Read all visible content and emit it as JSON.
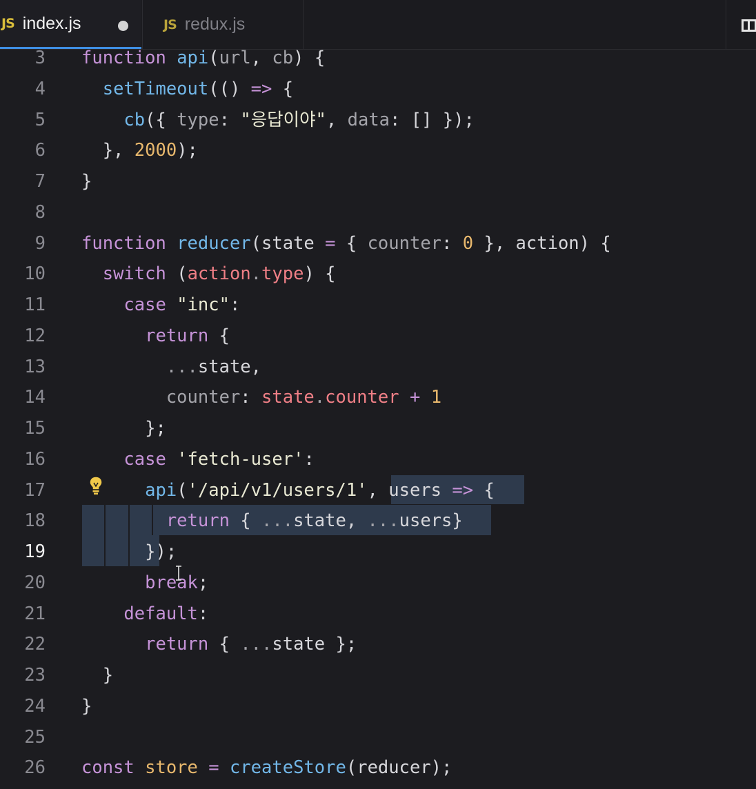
{
  "tabs": [
    {
      "icon": "JS",
      "name": "index.js",
      "dirty": true,
      "active": true
    },
    {
      "icon": "JS",
      "name": "redux.js",
      "dirty": false,
      "active": false
    }
  ],
  "editor": {
    "active_line": 19,
    "lines": [
      {
        "n": "3",
        "tokens": [
          [
            "kw",
            "function"
          ],
          [
            "pun",
            " "
          ],
          [
            "fn",
            "api"
          ],
          [
            "pun",
            "("
          ],
          [
            "dim",
            "url"
          ],
          [
            "pun",
            ", "
          ],
          [
            "dim",
            "cb"
          ],
          [
            "pun",
            ") {"
          ]
        ]
      },
      {
        "n": "4",
        "tokens": [
          [
            "pun",
            "  "
          ],
          [
            "fn",
            "setTimeout"
          ],
          [
            "pun",
            "(() "
          ],
          [
            "op",
            "=>"
          ],
          [
            "pun",
            " {"
          ]
        ]
      },
      {
        "n": "5",
        "tokens": [
          [
            "pun",
            "    "
          ],
          [
            "fn",
            "cb"
          ],
          [
            "pun",
            "({ "
          ],
          [
            "dim",
            "type"
          ],
          [
            "pun",
            ": "
          ],
          [
            "str",
            "\"응답이야\""
          ],
          [
            "pun",
            ", "
          ],
          [
            "dim",
            "data"
          ],
          [
            "pun",
            ": [] });"
          ]
        ]
      },
      {
        "n": "6",
        "tokens": [
          [
            "pun",
            "  }, "
          ],
          [
            "num",
            "2000"
          ],
          [
            "pun",
            ");"
          ]
        ]
      },
      {
        "n": "7",
        "tokens": [
          [
            "pun",
            "}"
          ]
        ]
      },
      {
        "n": "8",
        "tokens": []
      },
      {
        "n": "9",
        "tokens": [
          [
            "kw",
            "function"
          ],
          [
            "pun",
            " "
          ],
          [
            "fn",
            "reducer"
          ],
          [
            "pun",
            "("
          ],
          [
            "pun",
            "state "
          ],
          [
            "op",
            "="
          ],
          [
            "pun",
            " { "
          ],
          [
            "dim",
            "counter"
          ],
          [
            "pun",
            ": "
          ],
          [
            "num",
            "0"
          ],
          [
            "pun",
            " }, "
          ],
          [
            "pun",
            "action) {"
          ]
        ]
      },
      {
        "n": "10",
        "tokens": [
          [
            "pun",
            "  "
          ],
          [
            "kw",
            "switch"
          ],
          [
            "pun",
            " ("
          ],
          [
            "prop",
            "action"
          ],
          [
            "dim",
            "."
          ],
          [
            "prop",
            "type"
          ],
          [
            "pun",
            ") {"
          ]
        ]
      },
      {
        "n": "11",
        "tokens": [
          [
            "pun",
            "    "
          ],
          [
            "kw",
            "case"
          ],
          [
            "pun",
            " "
          ],
          [
            "str",
            "\"inc\""
          ],
          [
            "pun",
            ":"
          ]
        ]
      },
      {
        "n": "12",
        "tokens": [
          [
            "pun",
            "      "
          ],
          [
            "kw",
            "return"
          ],
          [
            "pun",
            " {"
          ]
        ]
      },
      {
        "n": "13",
        "tokens": [
          [
            "pun",
            "        "
          ],
          [
            "dim",
            "..."
          ],
          [
            "pun",
            "state,"
          ]
        ]
      },
      {
        "n": "14",
        "tokens": [
          [
            "pun",
            "        "
          ],
          [
            "dim",
            "counter"
          ],
          [
            "pun",
            ": "
          ],
          [
            "prop",
            "state"
          ],
          [
            "dim",
            "."
          ],
          [
            "prop",
            "counter"
          ],
          [
            "pun",
            " "
          ],
          [
            "op",
            "+"
          ],
          [
            "pun",
            " "
          ],
          [
            "num",
            "1"
          ]
        ]
      },
      {
        "n": "15",
        "tokens": [
          [
            "pun",
            "      };"
          ]
        ]
      },
      {
        "n": "16",
        "tokens": [
          [
            "pun",
            "    "
          ],
          [
            "kw",
            "case"
          ],
          [
            "pun",
            " "
          ],
          [
            "str",
            "'fetch-user'"
          ],
          [
            "pun",
            ":"
          ]
        ]
      },
      {
        "n": "17",
        "tokens": [
          [
            "pun",
            "      "
          ],
          [
            "fn",
            "api"
          ],
          [
            "pun",
            "("
          ],
          [
            "str",
            "'/api/v1/users/1'"
          ],
          [
            "pun",
            ", "
          ],
          [
            "pun",
            "users "
          ],
          [
            "op",
            "=>"
          ],
          [
            "pun",
            " {"
          ]
        ]
      },
      {
        "n": "18",
        "tokens": [
          [
            "pun",
            "        "
          ],
          [
            "kw",
            "return"
          ],
          [
            "pun",
            " { "
          ],
          [
            "dim",
            "..."
          ],
          [
            "pun",
            "state, "
          ],
          [
            "dim",
            "..."
          ],
          [
            "pun",
            "users}"
          ]
        ]
      },
      {
        "n": "19",
        "tokens": [
          [
            "pun",
            "      });"
          ]
        ]
      },
      {
        "n": "20",
        "tokens": [
          [
            "pun",
            "      "
          ],
          [
            "kw",
            "break"
          ],
          [
            "pun",
            ";"
          ]
        ]
      },
      {
        "n": "21",
        "tokens": [
          [
            "pun",
            "    "
          ],
          [
            "kw",
            "default"
          ],
          [
            "pun",
            ":"
          ]
        ]
      },
      {
        "n": "22",
        "tokens": [
          [
            "pun",
            "      "
          ],
          [
            "kw",
            "return"
          ],
          [
            "pun",
            " { "
          ],
          [
            "dim",
            "..."
          ],
          [
            "pun",
            "state };"
          ]
        ]
      },
      {
        "n": "23",
        "tokens": [
          [
            "pun",
            "  }"
          ]
        ]
      },
      {
        "n": "24",
        "tokens": [
          [
            "pun",
            "}"
          ]
        ]
      },
      {
        "n": "25",
        "tokens": []
      },
      {
        "n": "26",
        "tokens": [
          [
            "kw",
            "const"
          ],
          [
            "pun",
            " "
          ],
          [
            "num",
            "store"
          ],
          [
            "pun",
            " "
          ],
          [
            "op",
            "="
          ],
          [
            "pun",
            " "
          ],
          [
            "fn",
            "createStore"
          ],
          [
            "pun",
            "(reducer);"
          ]
        ]
      }
    ]
  },
  "colors": {
    "background": "#1c1c20",
    "selection": "#2e3a4c",
    "keyword": "#c693d8",
    "function": "#72b7e8",
    "number": "#e8b86d",
    "property": "#ef7f86",
    "js_badge": "#d9bd3b",
    "active_tab_border": "#3f8fe3"
  },
  "icons": {
    "lightbulb": "lightbulb-icon",
    "split_editor": "split-editor-icon",
    "text_cursor": "text-cursor-icon"
  }
}
